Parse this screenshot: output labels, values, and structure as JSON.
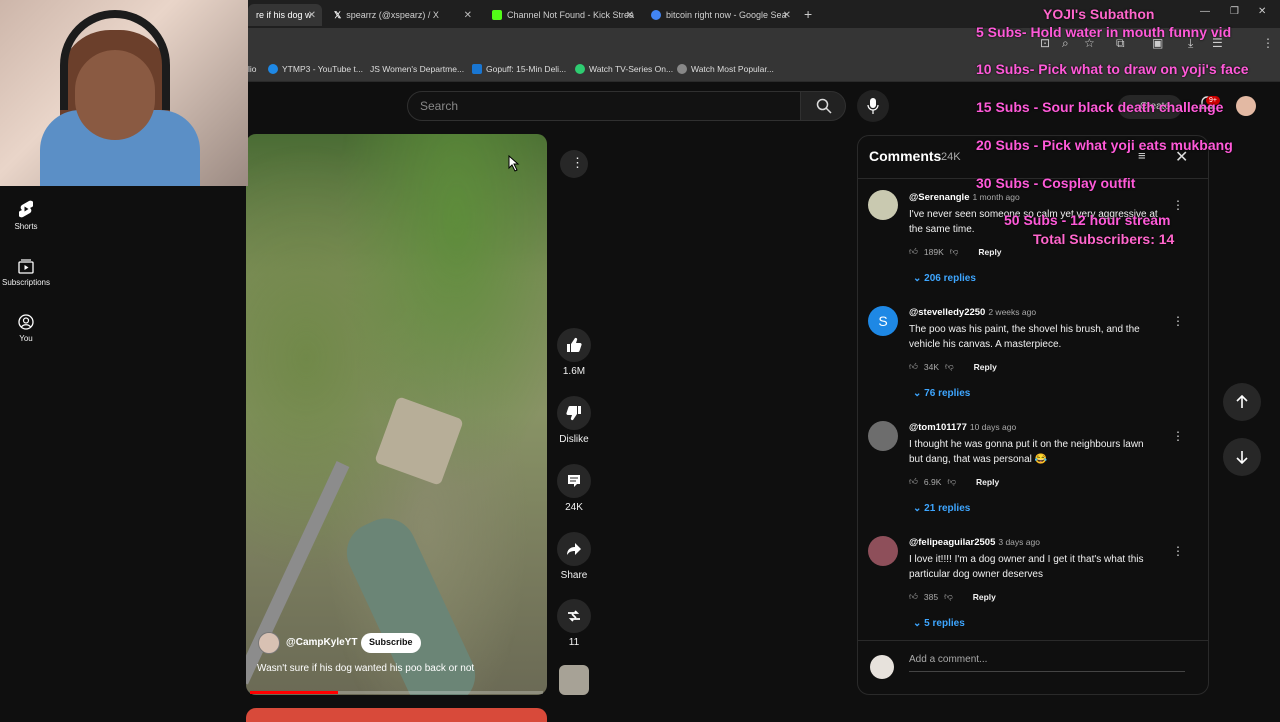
{
  "browser": {
    "tabs": [
      {
        "label": "re if his dog w",
        "active": true,
        "favicon_color": "#ff0000"
      },
      {
        "label": "spearrz (@xspearz) / X",
        "active": false,
        "favicon_color": "#ffffff"
      },
      {
        "label": "Channel Not Found - Kick Strea",
        "active": false,
        "favicon_color": "#53fc18"
      },
      {
        "label": "bitcoin right now - Google Sea",
        "active": false,
        "favicon_color": "#4285f4"
      }
    ],
    "new_tab": "+",
    "bookmarks": [
      {
        "label": "lio"
      },
      {
        "label": "YTMP3 - YouTube t..."
      },
      {
        "label": "JS  Women's Departme..."
      },
      {
        "label": "Gopuff: 15-Min Deli..."
      },
      {
        "label": "Watch TV-Series On..."
      },
      {
        "label": "Watch Most Popular..."
      }
    ]
  },
  "youtube": {
    "search_placeholder": "Search",
    "create_label": "Create",
    "notif_count": "9+",
    "nav": [
      {
        "label": "Shorts"
      },
      {
        "label": "Subscriptions"
      },
      {
        "label": "You"
      }
    ]
  },
  "short": {
    "channel": "@CampKyleYT",
    "subscribe_label": "Subscribe",
    "title": "Wasn't sure if his dog wanted his poo back or not",
    "progress": 0.3,
    "actions": {
      "likes": "1.6M",
      "dislike_label": "Dislike",
      "comments": "24K",
      "share_label": "Share",
      "remix": "11"
    }
  },
  "comments": {
    "title": "Comments",
    "count": "24K",
    "add_placeholder": "Add a comment...",
    "items": [
      {
        "author": "@Serenangle",
        "time": "1 month ago",
        "text": "I've never seen someone so calm yet very aggressive at the same time.",
        "likes": "189K",
        "reply_label": "Reply",
        "replies": "206 replies",
        "avatar_color": "#c9c9b0"
      },
      {
        "author": "@stevelledy2250",
        "time": "2 weeks ago",
        "text": "The poo was his paint, the shovel his brush, and the vehicle his canvas. A masterpiece.",
        "likes": "34K",
        "reply_label": "Reply",
        "replies": "76 replies",
        "avatar_color": "#1e88e5",
        "avatar_letter": "S"
      },
      {
        "author": "@tom101177",
        "time": "10 days ago",
        "text": "I thought he was gonna put it on the neighbours lawn but dang, that was personal 😂",
        "likes": "6.9K",
        "reply_label": "Reply",
        "replies": "21 replies",
        "avatar_color": "#6d6d6d"
      },
      {
        "author": "@felipeaguilar2505",
        "time": "3 days ago",
        "text": "I love it!!!! I'm a dog owner and I get it that's what this particular dog owner deserves",
        "likes": "385",
        "reply_label": "Reply",
        "replies": "5 replies",
        "avatar_color": "#8e4f5a"
      }
    ]
  },
  "overlay": {
    "title": "YOJI's Subathon",
    "goals": [
      "5 Subs- Hold water in mouth funny vid",
      "10 Subs- Pick what to draw on yoji's face",
      "15 Subs - Sour black death challenge",
      "20 Subs - Pick what yoji eats mukbang",
      "30 Subs - Cosplay outfit",
      "50 Subs - 12 hour stream"
    ],
    "total": "Total Subscribers: 14",
    "colors": {
      "title": "#ff66cc",
      "goals": "#ff5ad9"
    }
  }
}
